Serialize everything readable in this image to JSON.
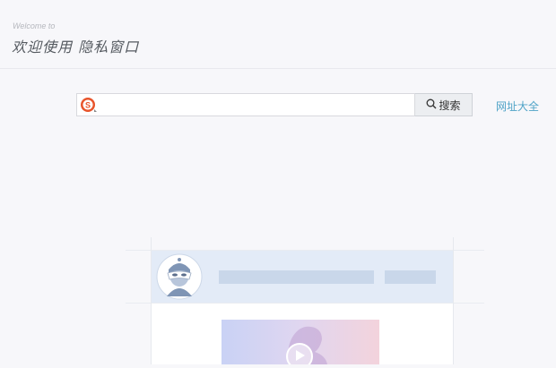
{
  "welcome": {
    "subtitle": "Welcome to",
    "title": "欢迎使用 隐私窗口"
  },
  "search": {
    "engine_icon": "sogou-logo-icon",
    "placeholder": "",
    "button_label": "搜索",
    "button_icon": "search-icon"
  },
  "links": {
    "url_directory": "网址大全"
  },
  "colors": {
    "link": "#4fa3c7",
    "engine_red": "#e8542b",
    "illustration_blue": "#e3ebf7"
  }
}
